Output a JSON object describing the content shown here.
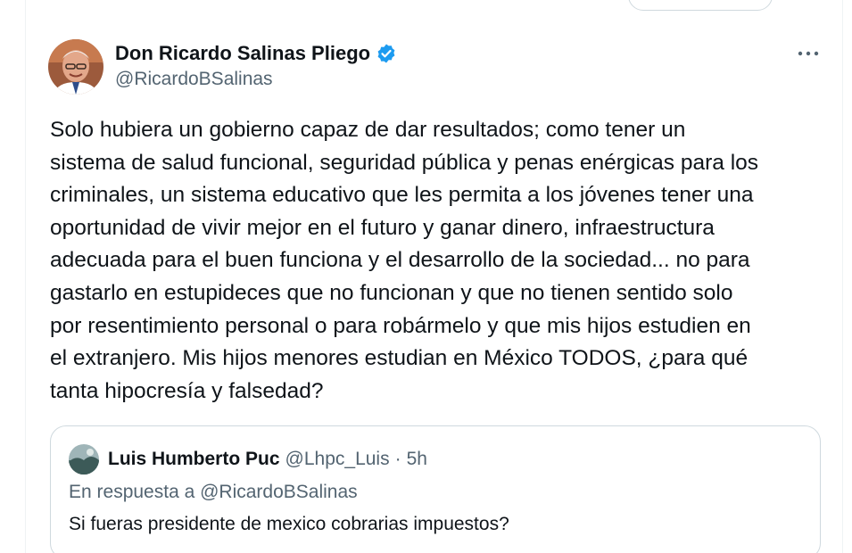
{
  "tweet": {
    "author": {
      "display_name": "Don Ricardo Salinas Pliego",
      "handle": "@RicardoBSalinas",
      "verified": true,
      "avatar_icon": "profile-photo-icon"
    },
    "text": "Solo hubiera un gobierno capaz de dar resultados; como tener un\nsistema de salud funcional, seguridad pública y penas enérgicas para los\ncriminales, un sistema educativo que les permita a los jóvenes tener una\noportunidad de vivir mejor en el futuro y ganar dinero, infraestructura\nadecuada para el buen funciona y el desarrollo de la sociedad... no para\ngastarlo en estupideces que no funcionan y que no tienen sentido solo\npor resentimiento personal o para robármelo y que mis hijos estudien en\nel extranjero. Mis hijos menores estudian en México TODOS, ¿para qué\ntanta hipocresía y falsedad?",
    "more_icon": "more-options-icon"
  },
  "quoted_tweet": {
    "display_name": "Luis Humberto Puc",
    "handle": "@Lhpc_Luis",
    "separator": "·",
    "time": "5h",
    "reply_context": "En respuesta a @RicardoBSalinas",
    "text": "Si fueras presidente de mexico cobrarias impuestos?"
  },
  "colors": {
    "text_primary": "#0f1419",
    "text_secondary": "#536471",
    "verified_blue": "#1d9bf0",
    "border": "#cfd9de"
  }
}
